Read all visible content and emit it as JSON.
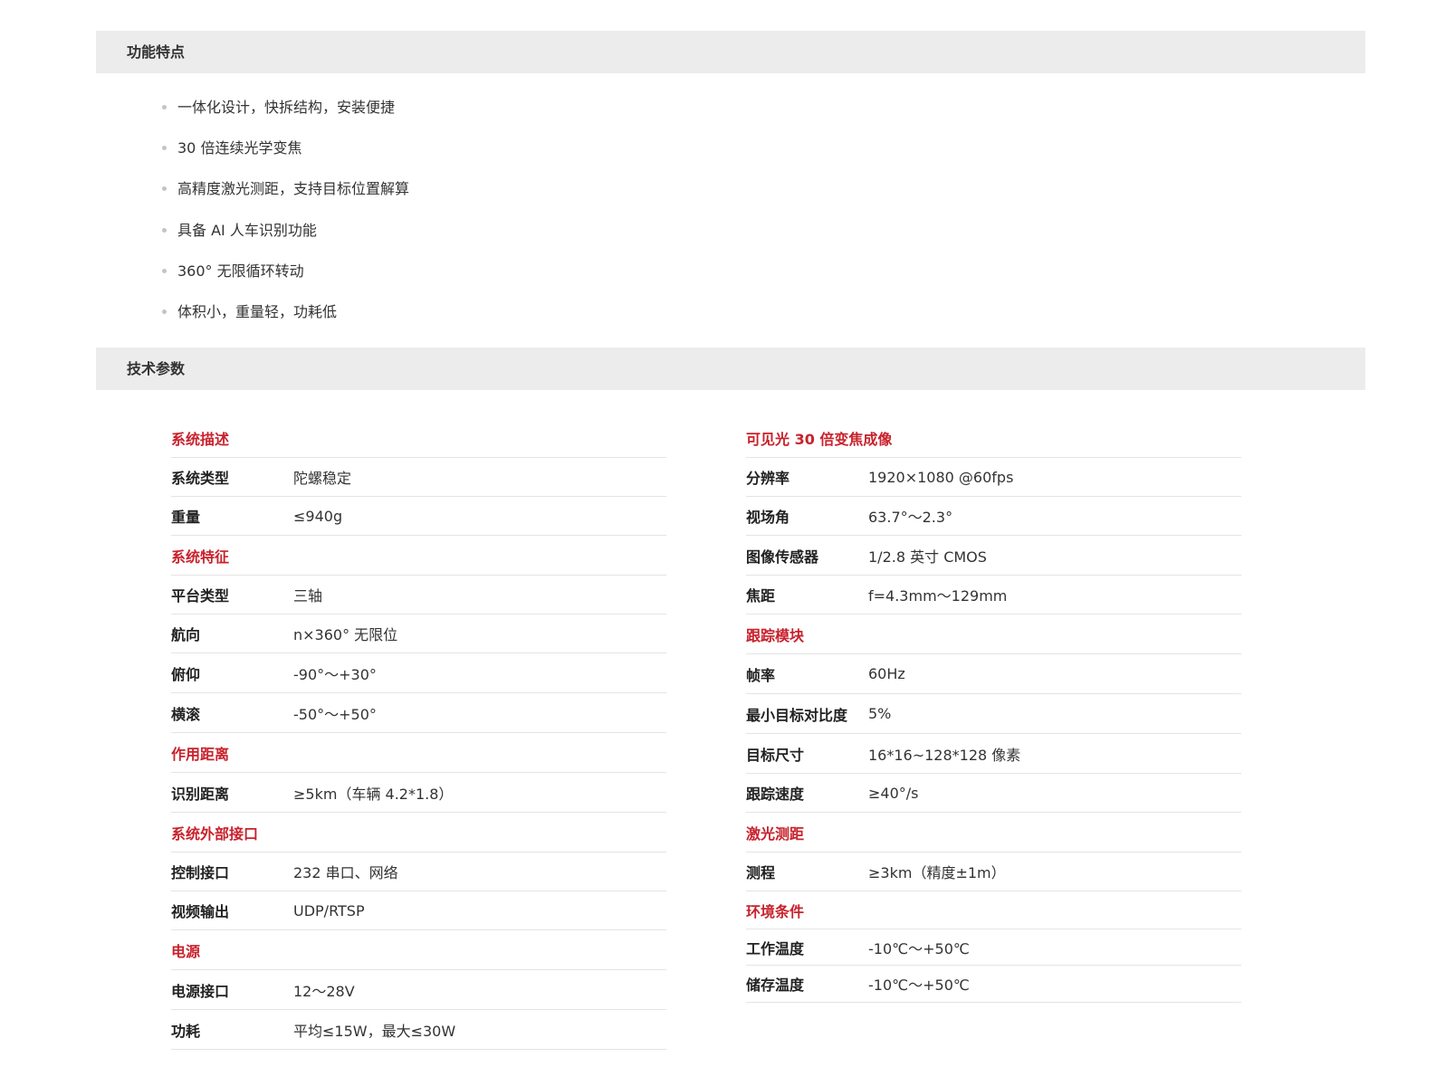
{
  "features": {
    "title": "功能特点",
    "items": [
      "一体化设计，快拆结构，安装便捷",
      "30 倍连续光学变焦",
      "高精度激光测距，支持目标位置解算",
      "具备 AI 人车识别功能",
      "360° 无限循环转动",
      "体积小，重量轻，功耗低"
    ]
  },
  "specs": {
    "title": "技术参数",
    "left": [
      {
        "group": "系统描述"
      },
      {
        "k": "系统类型",
        "v": "陀螺稳定"
      },
      {
        "k": "重量",
        "v": "≤940g"
      },
      {
        "group": "系统特征"
      },
      {
        "k": "平台类型",
        "v": "三轴"
      },
      {
        "k": "航向",
        "v": "n×360° 无限位"
      },
      {
        "k": "俯仰",
        "v": "-90°～+30°"
      },
      {
        "k": "横滚",
        "v": "-50°～+50°"
      },
      {
        "group": "作用距离"
      },
      {
        "k": "识别距离",
        "v": "≥5km（车辆 4.2*1.8）"
      },
      {
        "group": "系统外部接口"
      },
      {
        "k": "控制接口",
        "v": "232 串口、网络"
      },
      {
        "k": "视频输出",
        "v": "UDP/RTSP"
      },
      {
        "group": "电源"
      },
      {
        "k": "电源接口",
        "v": "12～28V"
      },
      {
        "k": "功耗",
        "v": "平均≤15W，最大≤30W"
      }
    ],
    "right": [
      {
        "group": "可见光 30 倍变焦成像"
      },
      {
        "k": "分辨率",
        "v": "1920×1080 @60fps"
      },
      {
        "k": "视场角",
        "v": "63.7°～2.3°"
      },
      {
        "k": "图像传感器",
        "v": "1/2.8 英寸 CMOS"
      },
      {
        "k": "焦距",
        "v": "f=4.3mm～129mm"
      },
      {
        "group": "跟踪模块"
      },
      {
        "k": "帧率",
        "v": "60Hz"
      },
      {
        "k": "最小目标对比度",
        "v": "5%"
      },
      {
        "k": "目标尺寸",
        "v": "16*16~128*128 像素"
      },
      {
        "k": "跟踪速度",
        "v": "≥40°/s"
      },
      {
        "group": "激光测距"
      },
      {
        "k": "测程",
        "v": "≥3km（精度±1m）"
      },
      {
        "group": "环境条件"
      },
      {
        "k": "工作温度",
        "v": "-10℃～+50℃"
      },
      {
        "k": "储存温度",
        "v": "-10℃～+50℃"
      }
    ]
  },
  "colors": {
    "group_heading": "#c8222c",
    "section_bar": "#ececec"
  }
}
